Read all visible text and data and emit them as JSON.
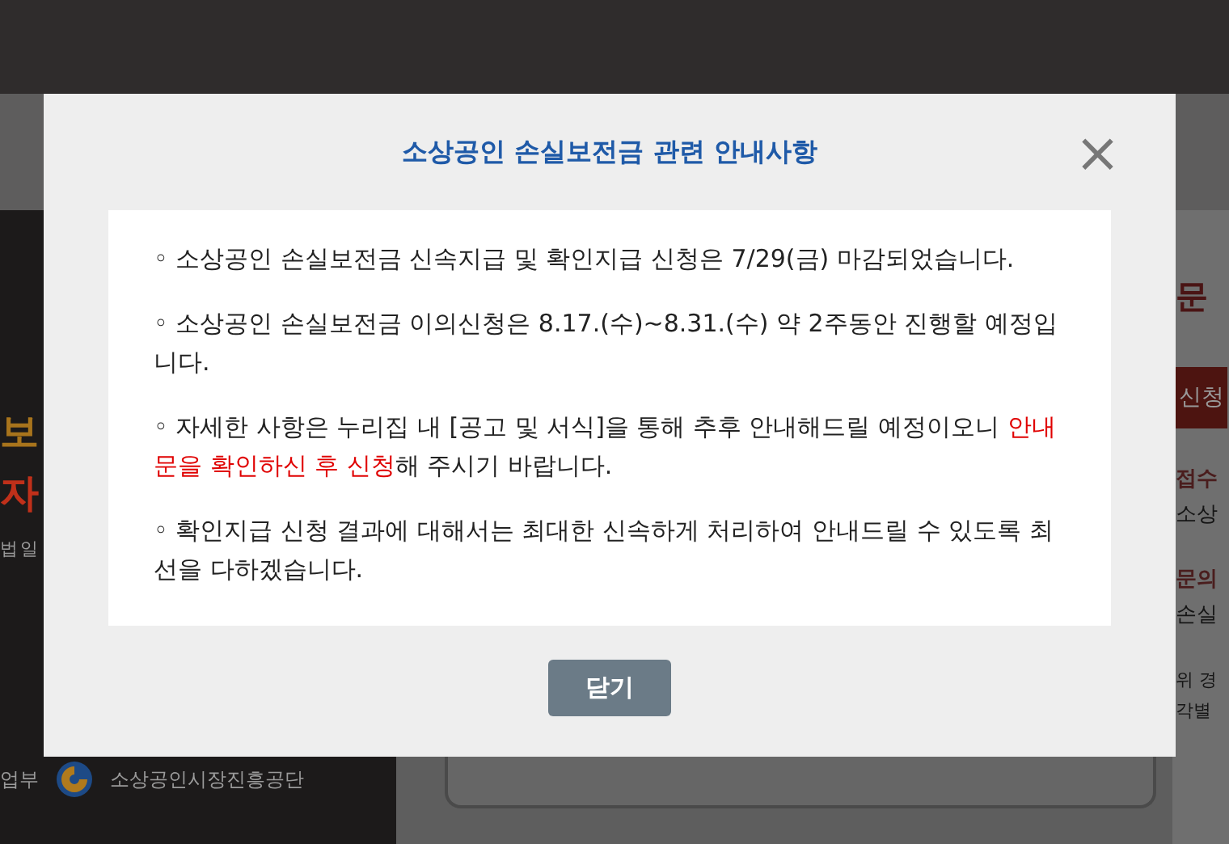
{
  "background": {
    "left": {
      "headline": [
        {
          "text": "보",
          "color": "#a8741c"
        },
        {
          "text": "자",
          "color": "#c0301a"
        }
      ],
      "subtitle": "법 일",
      "footer": "업부",
      "logo_text": "소상공인시장진흥공단"
    },
    "right": {
      "heading": "문",
      "button": "신청",
      "items": [
        {
          "label": "접수",
          "value": "소상"
        },
        {
          "label": "문의",
          "value": "손실"
        }
      ],
      "note_lines": [
        "위 경",
        "각별"
      ]
    }
  },
  "modal": {
    "title": "소상공인 손실보전금 관련 안내사항",
    "close": "×",
    "paragraphs": [
      [
        {
          "text": "◦ 소상공인 손실보전금 신속지급 및 확인지급 신청은 7/29(금) 마감되었습니다.",
          "highlight": false
        }
      ],
      [
        {
          "text": "◦ 소상공인 손실보전금 이의신청은 8.17.(수)~8.31.(수) 약 2주동안 진행할 예정입니다.",
          "highlight": false
        }
      ],
      [
        {
          "text": "◦ 자세한 사항은 누리집 내 [공고 및 서식]을 통해 추후 안내해드릴 예정이오니 ",
          "highlight": false
        },
        {
          "text": "안내문을 확인하신 후 신청",
          "highlight": true
        },
        {
          "text": "해 주시기 바랍니다.",
          "highlight": false
        }
      ],
      [
        {
          "text": "◦ 확인지급 신청 결과에 대해서는 최대한 신속하게 처리하여 안내드릴 수 있도록 최선을 다하겠습니다.",
          "highlight": false
        }
      ]
    ],
    "button": "닫기"
  }
}
